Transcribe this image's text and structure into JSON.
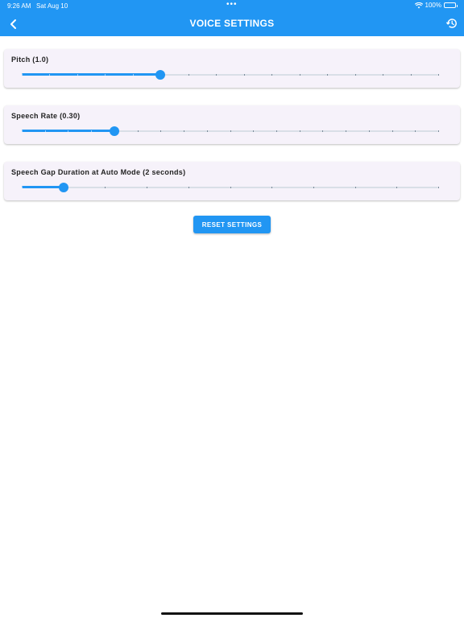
{
  "status_bar": {
    "time": "9:26 AM",
    "date": "Sat Aug 10",
    "dots": "•••",
    "battery": "100%"
  },
  "header": {
    "title": "VOICE SETTINGS",
    "back_icon": "chevron-left-icon",
    "history_icon": "history-icon"
  },
  "settings": [
    {
      "label": "Pitch (1.0)",
      "value": 0.333,
      "ticks": 15
    },
    {
      "label": "Speech Rate (0.30)",
      "value": 0.222,
      "ticks": 18
    },
    {
      "label": "Speech Gap Duration at Auto Mode (2 seconds)",
      "value": 0.1,
      "ticks": 10
    }
  ],
  "reset_button": {
    "label": "RESET SETTINGS"
  },
  "colors": {
    "accent": "#2196F3",
    "card_bg": "#f6f2fa"
  }
}
